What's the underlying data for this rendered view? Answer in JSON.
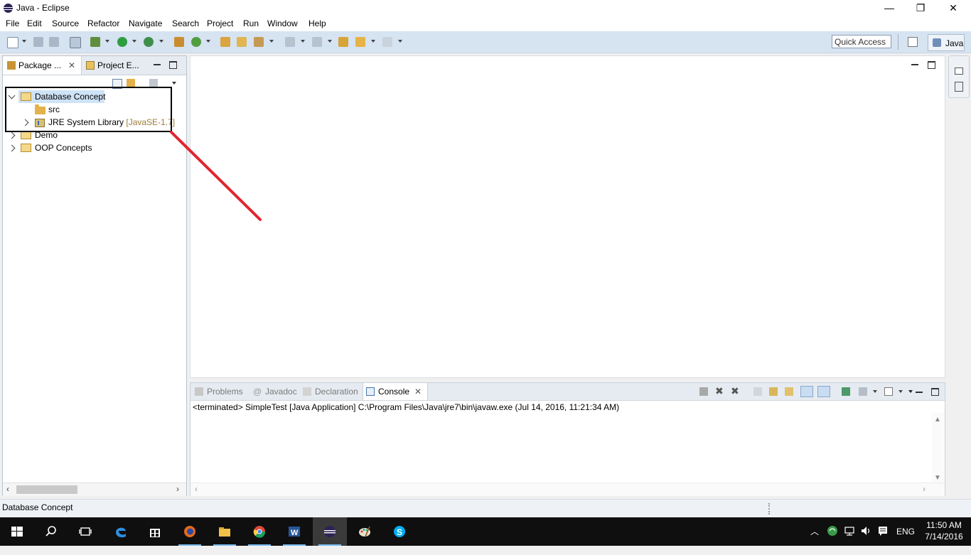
{
  "window": {
    "title": "Java - Eclipse",
    "controls": {
      "minimize": "—",
      "restore": "❐",
      "close": "✕"
    }
  },
  "menu": [
    "File",
    "Edit",
    "Source",
    "Refactor",
    "Navigate",
    "Search",
    "Project",
    "Run",
    "Window",
    "Help"
  ],
  "toolbar": {
    "quick_access_placeholder": "Quick Access",
    "perspective_label": "Java"
  },
  "package_explorer": {
    "tabs": [
      {
        "label": "Package ...",
        "close": "✕"
      },
      {
        "label": "Project E..."
      }
    ],
    "tree": [
      {
        "label": "Database Concept",
        "expanded": true,
        "selected": true,
        "children": [
          {
            "label": "src"
          },
          {
            "label": "JRE System Library",
            "suffix": "[JavaSE-1.7]"
          }
        ]
      },
      {
        "label": "Demo"
      },
      {
        "label": "OOP Concepts"
      }
    ]
  },
  "console_panel": {
    "tabs": [
      "Problems",
      "Javadoc",
      "Declaration",
      "Console"
    ],
    "active_tab": "Console",
    "close": "✕",
    "output": "<terminated> SimpleTest [Java Application] C:\\Program Files\\Java\\jre7\\bin\\javaw.exe (Jul 14, 2016, 11:21:34 AM)"
  },
  "status": {
    "text": "Database Concept"
  },
  "taskbar": {
    "language": "ENG",
    "time": "11:50 AM",
    "date": "7/14/2016"
  },
  "colors": {
    "toolbar_bg": "#d6e3f1",
    "selection": "#cfe3f7",
    "annotation_red": "#e0262f",
    "taskbar_bg": "#0f0f10"
  }
}
